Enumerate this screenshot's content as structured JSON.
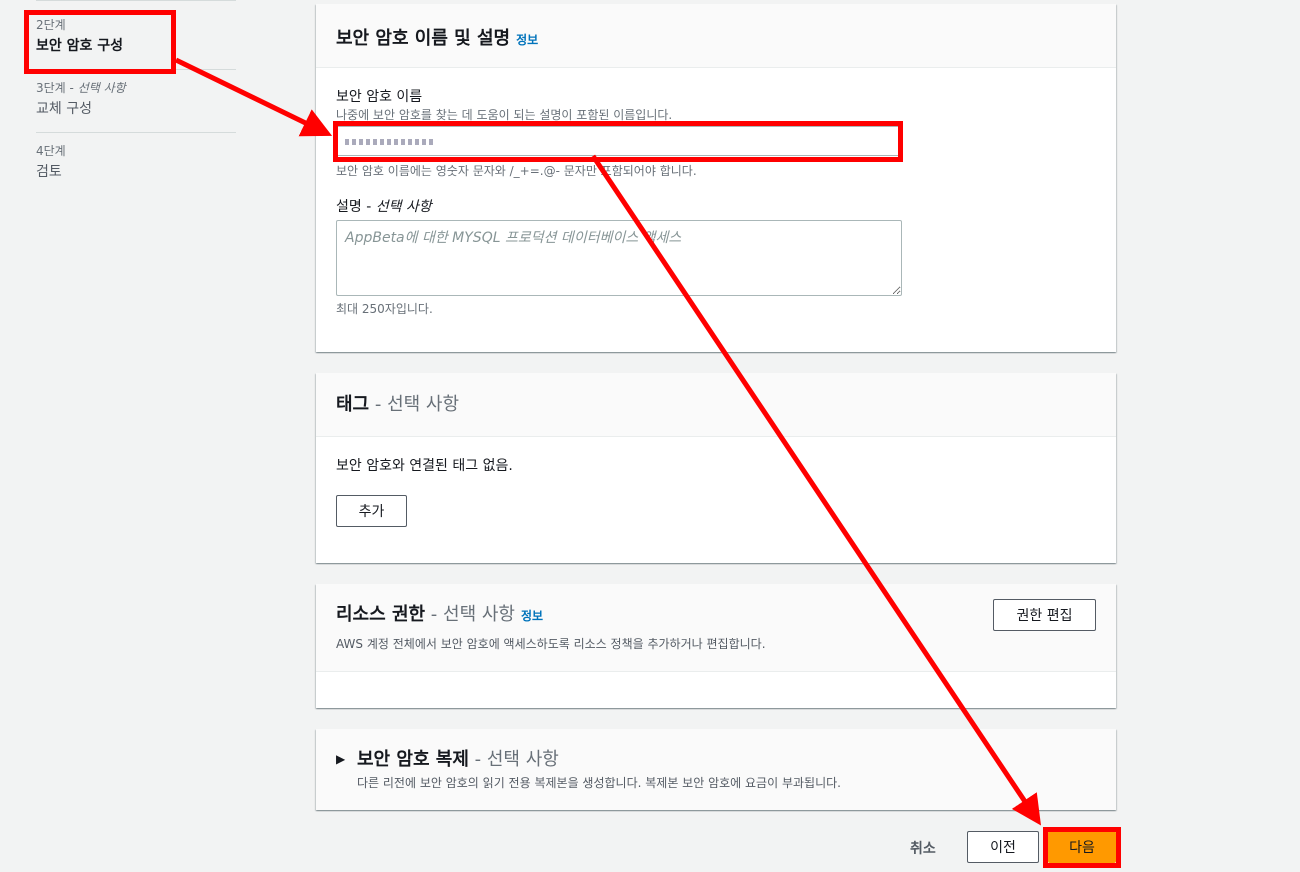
{
  "sidebar": {
    "steps": [
      {
        "num": "2단계",
        "opt": "",
        "title": "보안 암호 구성"
      },
      {
        "num": "3단계",
        "opt": "선택 사항",
        "title": "교체 구성"
      },
      {
        "num": "4단계",
        "opt": "",
        "title": "검토"
      }
    ],
    "opt_sep": " - "
  },
  "secret_panel": {
    "title": "보안 암호 이름 및 설명",
    "info": "정보",
    "name_label": "보안 암호 이름",
    "name_desc": "나중에 보안 암호를 찾는 데 도움이 되는 설명이 포함된 이름입니다.",
    "name_constraint": "보안 암호 이름에는 영숫자 문자와 /_+=.@- 문자만 포함되어야 합니다.",
    "desc_label": "설명",
    "desc_opt": "선택 사항",
    "desc_placeholder": "AppBeta에 대한 MYSQL 프로덕션 데이터베이스 액세스",
    "desc_constraint": "최대 250자입니다."
  },
  "tags_panel": {
    "title": "태그",
    "opt": "선택 사항",
    "empty": "보안 암호와 연결된 태그 없음.",
    "add_button": "추가"
  },
  "resource_panel": {
    "title": "리소스 권한",
    "opt": "선택 사항",
    "info": "정보",
    "desc": "AWS 계정 전체에서 보안 암호에 액세스하도록 리소스 정책을 추가하거나 편집합니다.",
    "edit_button": "권한 편집"
  },
  "replicate_panel": {
    "title": "보안 암호 복제",
    "opt": "선택 사항",
    "desc": "다른 리전에 보안 암호의 읽기 전용 복제본을 생성합니다. 복제본 보안 암호에 요금이 부과됩니다."
  },
  "footer": {
    "cancel": "취소",
    "previous": "이전",
    "next": "다음"
  },
  "colors": {
    "annotation": "#ff0000",
    "primary": "#ff9900",
    "link": "#0073bb"
  }
}
